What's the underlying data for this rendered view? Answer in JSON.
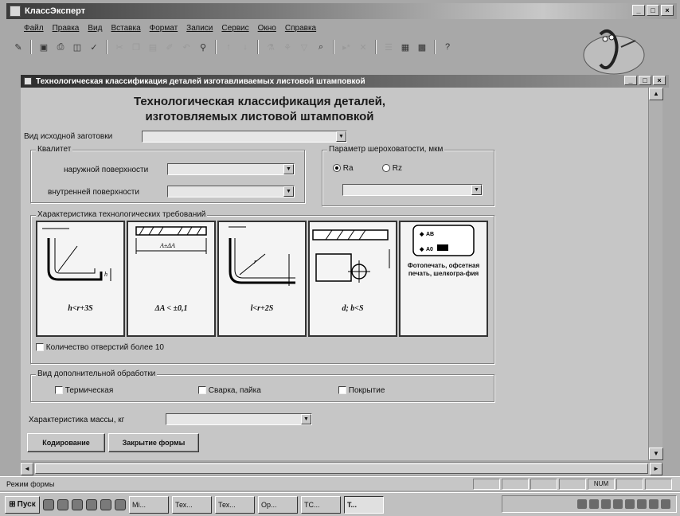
{
  "app": {
    "title": "КлассЭксперт",
    "win_buttons": [
      "_",
      "□",
      "×"
    ]
  },
  "menu": [
    "Файл",
    "Правка",
    "Вид",
    "Вставка",
    "Формат",
    "Записи",
    "Сервис",
    "Окно",
    "Справка"
  ],
  "form": {
    "window_title": "Технологическая классификация деталей изготавливаемых листовой штамповкой",
    "heading_line1": "Технологическая классификация деталей,",
    "heading_line2": "изготовляемых листовой штамповкой",
    "blank_type_label": "Вид исходной заготовки",
    "blank_type_value": "",
    "quality_group": "Квалитет",
    "outer_surface_label": "наружной поверхности",
    "outer_surface_value": "",
    "inner_surface_label": "внутренней поверхности",
    "inner_surface_value": "",
    "roughness_group": "Параметр шероховатости, мкм",
    "ra_label": "Ra",
    "rz_label": "Rz",
    "roughness_value": "",
    "tech_req_group": "Характеристика технологических требований",
    "cards": [
      {
        "caption": "h<r+3S"
      },
      {
        "caption": "ΔA < ±0,1",
        "dim": "A±ΔA"
      },
      {
        "caption": "l<r+2S"
      },
      {
        "caption": "d; b<S"
      },
      {
        "caption": "Фотопечать, офсетная печать, шелкогра-фия",
        "marks": [
          "A0",
          "AB"
        ]
      }
    ],
    "holes_checkbox": "Количество отверстий более 10",
    "extra_group": "Вид дополнительной обработки",
    "extra_options": [
      "Термическая",
      "Сварка, пайка",
      "Покрытие"
    ],
    "mass_label": "Характеристика массы, кг",
    "mass_value": "",
    "btn_encode": "Кодирование",
    "btn_close": "Закрытие формы"
  },
  "status": {
    "text": "Режим формы",
    "cells": [
      "",
      "",
      "",
      "",
      "NUM",
      "",
      ""
    ]
  },
  "taskbar": {
    "start": "Пуск",
    "tasks": [
      "Mi...",
      "Тех...",
      "Тех...",
      "Ор...",
      "ТС...",
      "Т..."
    ],
    "active_index": 5,
    "clock": ""
  }
}
